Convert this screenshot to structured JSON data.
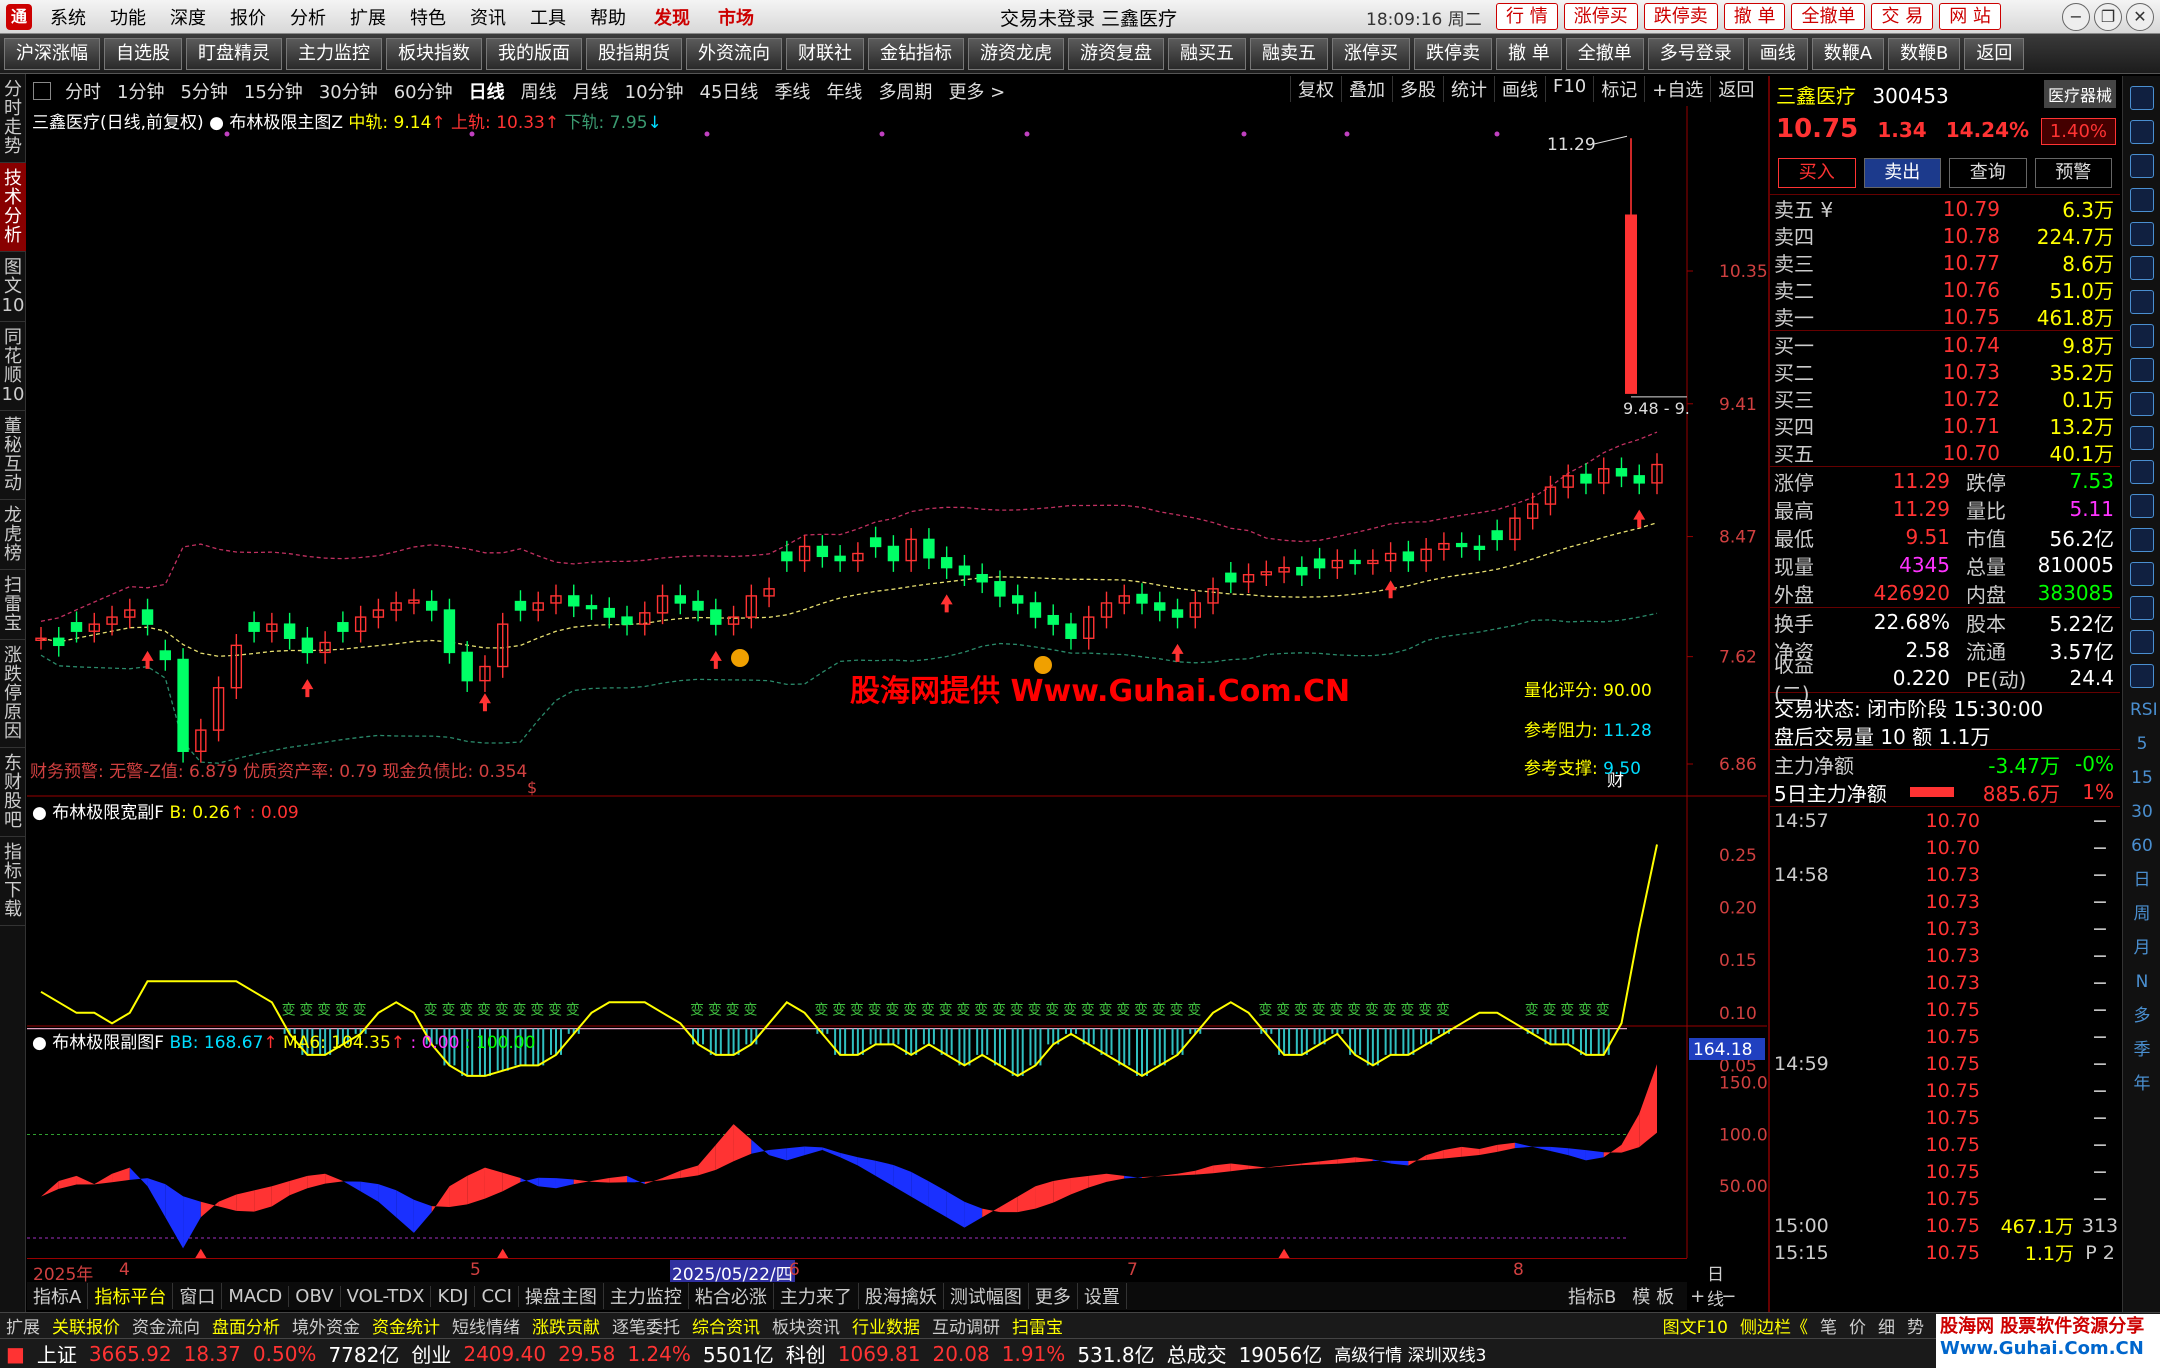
{
  "menubar": {
    "items": [
      "系统",
      "功能",
      "深度",
      "报价",
      "分析",
      "扩展",
      "特色",
      "资讯",
      "工具",
      "帮助"
    ],
    "discover": "发现",
    "market": "市场",
    "title": "交易未登录  三鑫医疗",
    "time": "18:09:16 周二",
    "right_buttons": [
      "行 情",
      "涨停买",
      "跌停卖",
      "撤 单",
      "全撤单",
      "交 易",
      "网 站"
    ]
  },
  "toolbar": {
    "buttons": [
      "沪深涨幅",
      "自选股",
      "盯盘精灵",
      "主力监控",
      "板块指数",
      "我的版面",
      "股指期货",
      "外资流向",
      "财联社",
      "金钻指标",
      "游资龙虎",
      "游资复盘",
      "融买五",
      "融卖五",
      "涨停买",
      "跌停卖",
      "撤 单",
      "全撤单",
      "多号登录",
      "画线",
      "数鞭A",
      "数鞭B",
      "返回"
    ]
  },
  "left_tabs": [
    "分时走势",
    "技术分析",
    "图文10",
    "同花顺10",
    "董秘互动",
    "龙虎榜",
    "扫雷宝",
    "涨跌停原因",
    "东财股吧",
    "指标下载"
  ],
  "period_bar": {
    "periods": [
      "分时",
      "1分钟",
      "5分钟",
      "15分钟",
      "30分钟",
      "60分钟",
      "日线",
      "周线",
      "月线",
      "10分钟",
      "45日线",
      "季线",
      "年线",
      "多周期",
      "更多 >"
    ],
    "active": "日线",
    "right_funcs": [
      "复权",
      "叠加",
      "多股",
      "统计",
      "画线",
      "F10",
      "标记",
      "+自选",
      "返回"
    ]
  },
  "main_chart": {
    "legend": {
      "name": "三鑫医疗(日线,前复权)",
      "indicator": "布林极限主图Z",
      "mid_label": "中轨:",
      "mid_value": "9.14",
      "upper_label": "上轨:",
      "upper_value": "10.33",
      "lower_label": "下轨:",
      "lower_value": "7.95"
    },
    "price_axis": [
      "10.35",
      "9.41",
      "8.47",
      "7.62",
      "6.86"
    ],
    "high_marker": "11.29",
    "close_marker": "9.48 - 9.",
    "watermark": "股海网提供 Www.Guhai.Com.CN",
    "fin_warning": "财务预警: 无警-Z值: 6.879 优质资产率: 0.79 现金负债比: 0.354",
    "quant_score_label": "量化评分:",
    "quant_score": "90.00",
    "resist_label": "参考阻力:",
    "resist": "11.28",
    "support_label": "参考支撑:",
    "support": "9.50",
    "cai_tag": "财",
    "dollar_tag": "$"
  },
  "sub1": {
    "legend_name": "布林极限宽副F",
    "b_label": "B:",
    "b_value": "0.26",
    "b2_value": ": 0.09",
    "axis": [
      "0.25",
      "0.20",
      "0.15",
      "0.10",
      "0.05"
    ],
    "band_text": "变变变变变"
  },
  "sub2": {
    "legend_name": "布林极限副图F",
    "bb_label": "BB:",
    "bb_value": "168.67",
    "ma_label": "MA6:",
    "ma_value": "104.35",
    "v1": ": 0.00",
    "v2": ": 100.00",
    "axis": [
      "150.0",
      "100.0",
      "50.00"
    ],
    "cur_value": "164.18"
  },
  "date_bar": {
    "year": "2025年",
    "m4": "4",
    "m5": "5",
    "highlight": "2025/05/22/四",
    "m6": "6",
    "m7": "7",
    "m8": "8",
    "right_tab": "日线"
  },
  "indicator_bar": {
    "items": [
      "指标A",
      "指标平台",
      "窗口",
      "MACD",
      "OBV",
      "VOL-TDX",
      "KDJ",
      "CCI",
      "操盘主图",
      "主力监控",
      "粘合必涨",
      "主力来了",
      "股海擒妖",
      "测试幅图",
      "更多",
      "设置"
    ],
    "selected": "指标平台",
    "right_items": [
      "指标B",
      "模 板",
      "+",
      "−"
    ]
  },
  "quote": {
    "name": "三鑫医疗",
    "code": "300453",
    "sector": "医疗器械",
    "price": "10.75",
    "change": "1.34",
    "change_pct": "14.24%",
    "badge": "1.40%",
    "actions": [
      "买入",
      "卖出",
      "查询",
      "预警"
    ],
    "asks": [
      {
        "label": "卖五 ¥",
        "price": "10.79",
        "vol": "6.3万"
      },
      {
        "label": "卖四",
        "price": "10.78",
        "vol": "224.7万"
      },
      {
        "label": "卖三",
        "price": "10.77",
        "vol": "8.6万"
      },
      {
        "label": "卖二",
        "price": "10.76",
        "vol": "51.0万"
      },
      {
        "label": "卖一",
        "price": "10.75",
        "vol": "461.8万"
      }
    ],
    "bids": [
      {
        "label": "买一",
        "price": "10.74",
        "vol": "9.8万"
      },
      {
        "label": "买二",
        "price": "10.73",
        "vol": "35.2万"
      },
      {
        "label": "买三",
        "price": "10.72",
        "vol": "0.1万"
      },
      {
        "label": "买四",
        "price": "10.71",
        "vol": "13.2万"
      },
      {
        "label": "买五",
        "price": "10.70",
        "vol": "40.1万"
      }
    ],
    "stats": [
      {
        "k1": "涨停",
        "v1": "11.29",
        "c1": "red",
        "k2": "跌停",
        "v2": "7.53",
        "c2": "grn"
      },
      {
        "k1": "最高",
        "v1": "11.29",
        "c1": "red",
        "k2": "量比",
        "v2": "5.11",
        "c2": "mag"
      },
      {
        "k1": "最低",
        "v1": "9.51",
        "c1": "red",
        "k2": "市值",
        "v2": "56.2亿",
        "c2": "wht"
      },
      {
        "k1": "现量",
        "v1": "4345",
        "c1": "mag",
        "k2": "总量",
        "v2": "810005",
        "c2": "wht"
      },
      {
        "k1": "外盘",
        "v1": "426920",
        "c1": "red",
        "k2": "内盘",
        "v2": "383085",
        "c2": "grn"
      }
    ],
    "stats2": [
      {
        "k1": "换手",
        "v1": "22.68%",
        "c1": "wht",
        "k2": "股本",
        "v2": "5.22亿",
        "c2": "wht"
      },
      {
        "k1": "净资",
        "v1": "2.58",
        "c1": "wht",
        "k2": "流通",
        "v2": "3.57亿",
        "c2": "wht"
      },
      {
        "k1": "收益(二)",
        "v1": "0.220",
        "c1": "wht",
        "k2": "PE(动)",
        "v2": "24.4",
        "c2": "wht"
      }
    ],
    "trade_status": "交易状态: 闭市阶段 15:30:00",
    "after_hours": "盘后交易量 10 额 1.1万",
    "main_net_label": "主力净额",
    "main_net": "-3.47万",
    "main_net_pct": "-0%",
    "main5_label": "5日主力净额",
    "main5": "885.6万",
    "main5_pct": "1%",
    "ticks": [
      {
        "t": "14:57",
        "p": "10.70",
        "v": "",
        "b": "−"
      },
      {
        "t": "",
        "p": "10.70",
        "v": "",
        "b": "−"
      },
      {
        "t": "14:58",
        "p": "10.73",
        "v": "",
        "b": "−"
      },
      {
        "t": "",
        "p": "10.73",
        "v": "",
        "b": "−"
      },
      {
        "t": "",
        "p": "10.73",
        "v": "",
        "b": "−"
      },
      {
        "t": "",
        "p": "10.73",
        "v": "",
        "b": "−"
      },
      {
        "t": "",
        "p": "10.73",
        "v": "",
        "b": "−"
      },
      {
        "t": "",
        "p": "10.75",
        "v": "",
        "b": "−"
      },
      {
        "t": "",
        "p": "10.75",
        "v": "",
        "b": "−"
      },
      {
        "t": "14:59",
        "p": "10.75",
        "v": "",
        "b": "−"
      },
      {
        "t": "",
        "p": "10.75",
        "v": "",
        "b": "−"
      },
      {
        "t": "",
        "p": "10.75",
        "v": "",
        "b": "−"
      },
      {
        "t": "",
        "p": "10.75",
        "v": "",
        "b": "−"
      },
      {
        "t": "",
        "p": "10.75",
        "v": "",
        "b": "−"
      },
      {
        "t": "",
        "p": "10.75",
        "v": "",
        "b": "−"
      },
      {
        "t": "15:00",
        "p": "10.75",
        "v": "467.1万",
        "b": "313"
      },
      {
        "t": "15:15",
        "p": "10.75",
        "v": "1.1万",
        "b": "P  2"
      }
    ]
  },
  "right_icons_text": [
    "RSI",
    "5",
    "15",
    "30",
    "60",
    "日",
    "周",
    "月",
    "N",
    "多",
    "季",
    "年"
  ],
  "statusbar1": [
    "扩展",
    "关联报价",
    "资金流向",
    "盘面分析",
    "境外资金",
    "资金统计",
    "短线情绪",
    "涨跌贡献",
    "逐笔委托",
    "综合资讯",
    "板块资讯",
    "行业数据",
    "互动调研",
    "扫雷宝"
  ],
  "statusbar1_right": [
    "图文F10",
    "侧边栏《",
    "笔",
    "价",
    "细",
    "势"
  ],
  "index_bar": {
    "sh_label": "上证",
    "sh": "3665.92",
    "sh_chg": "18.37",
    "sh_pct": "0.50%",
    "sh_amt": "7782亿",
    "cy_label": "创业",
    "cy": "2409.40",
    "cy_chg": "29.58",
    "cy_pct": "1.24%",
    "cy_amt": "5501亿",
    "kc_label": "科创",
    "kc": "1069.81",
    "kc_chg": "20.08",
    "kc_pct": "1.91%",
    "kc_amt": "531.8亿",
    "total_label": "总成交",
    "total": "19056亿",
    "feed": "高级行情  深圳双线3"
  },
  "guhai": {
    "line1": "股海网 股票软件资源分享",
    "line2": "Www.Guhai.Com.CN"
  },
  "colors": {
    "up": "#ff3333",
    "down": "#00ff00",
    "bg": "#000000",
    "axis": "#990000",
    "yellow": "#ffff00",
    "cyan": "#00ddff"
  }
}
